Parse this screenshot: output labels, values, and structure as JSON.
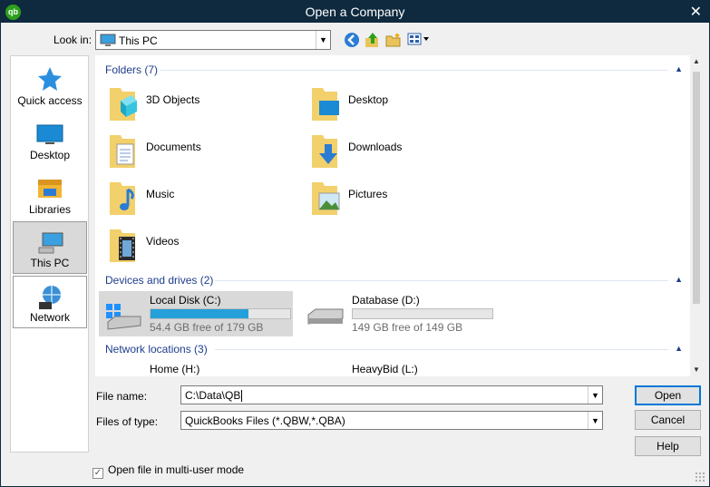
{
  "window": {
    "title": "Open a Company",
    "app_badge": "qb"
  },
  "toolbar": {
    "lookin_label": "Look in:",
    "lookin_value": "This PC",
    "icons": [
      "back-icon",
      "up-folder-icon",
      "new-folder-icon",
      "view-menu-icon"
    ]
  },
  "places": [
    {
      "label": "Quick access",
      "icon": "star-icon"
    },
    {
      "label": "Desktop",
      "icon": "desktop-icon"
    },
    {
      "label": "Libraries",
      "icon": "libraries-icon"
    },
    {
      "label": "This PC",
      "icon": "computer-icon",
      "selected": true
    },
    {
      "label": "Network",
      "icon": "network-icon"
    }
  ],
  "groups": {
    "folders_header": "Folders (7)",
    "devices_header": "Devices and drives (2)",
    "network_header": "Network locations (3)"
  },
  "folders": [
    {
      "label": "3D Objects",
      "icon": "3d-objects-icon"
    },
    {
      "label": "Desktop",
      "icon": "desktop-folder-icon"
    },
    {
      "label": "Documents",
      "icon": "documents-folder-icon"
    },
    {
      "label": "Downloads",
      "icon": "downloads-folder-icon"
    },
    {
      "label": "Music",
      "icon": "music-folder-icon"
    },
    {
      "label": "Pictures",
      "icon": "pictures-folder-icon"
    },
    {
      "label": "Videos",
      "icon": "videos-folder-icon"
    }
  ],
  "drives": [
    {
      "name": "Local Disk (C:)",
      "free": "54.4 GB free of 179 GB",
      "used_fraction": 0.7,
      "selected": true
    },
    {
      "name": "Database (D:)",
      "free": "149 GB free of 149 GB",
      "used_fraction": 0.0
    }
  ],
  "network_locations": [
    {
      "label": "Home (H:)"
    },
    {
      "label": "HeavyBid (L:)"
    }
  ],
  "form": {
    "file_name_label": "File name:",
    "file_name_value": "C:\\Data\\QB",
    "file_type_label": "Files of type:",
    "file_type_value": "QuickBooks Files (*.QBW,*.QBA)"
  },
  "buttons": {
    "open": "Open",
    "cancel": "Cancel",
    "help": "Help"
  },
  "multiuser": {
    "label": "Open file in multi-user mode",
    "checked": true
  },
  "colors": {
    "title_bar": "#0f2a3f",
    "group_header": "#1e3d8c",
    "drive_bar": "#26a0da",
    "selection": "#d9d9d9"
  }
}
